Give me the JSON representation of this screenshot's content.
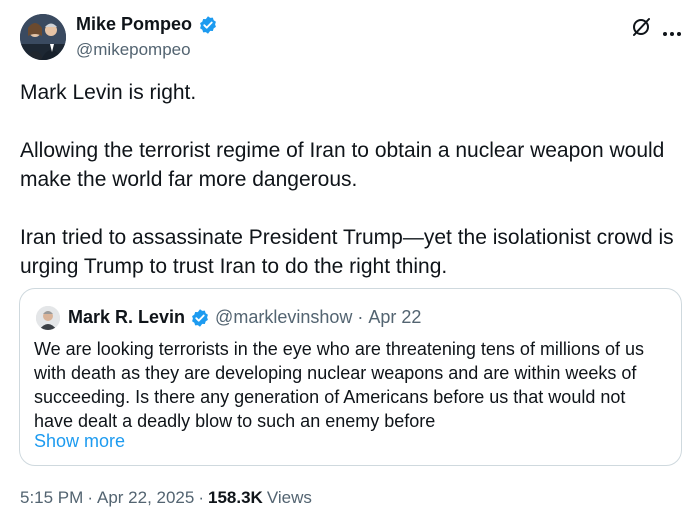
{
  "author": {
    "name": "Mike Pompeo",
    "handle": "@mikepompeo"
  },
  "tweet": {
    "paragraphs": [
      "Mark Levin is right.",
      "Allowing the terrorist regime of Iran to obtain a nuclear weapon would make the world far more dangerous.",
      "Iran tried to assassinate President Trump—yet the isolationist crowd is urging Trump to trust Iran to do the right thing."
    ]
  },
  "quote": {
    "name": "Mark R. Levin",
    "handle": "@marklevinshow",
    "separator": "·",
    "date": "Apr 22",
    "text": "We are looking terrorists in the eye who are threatening tens of millions of us with death as they are developing nuclear weapons and are within weeks of succeeding.  Is there any generation of Americans before us that would not have dealt a deadly blow to such an enemy before",
    "show_more": "Show more"
  },
  "meta": {
    "time": "5:15 PM",
    "sep1": "·",
    "date": "Apr 22, 2025",
    "sep2": "·",
    "views_count": "158.3K",
    "views_label": "Views"
  },
  "colors": {
    "verified": "#1d9bf0",
    "link": "#1d9bf0",
    "muted": "#536471"
  }
}
